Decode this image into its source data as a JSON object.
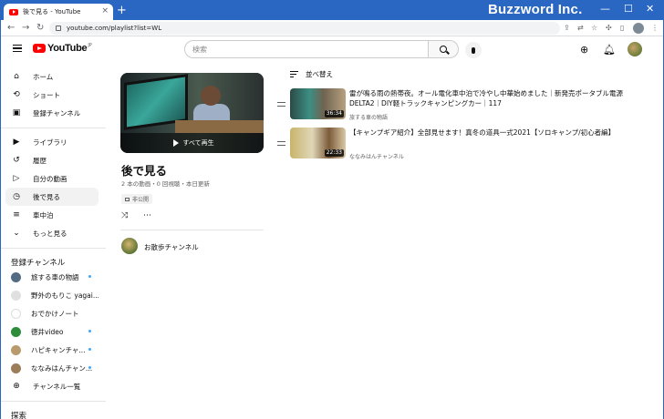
{
  "browser": {
    "tab_title": "後で見る - YouTube",
    "tab_close": "×",
    "new_tab": "+",
    "brand": "Buzzword Inc.",
    "win_min": "—",
    "win_max": "☐",
    "win_close": "✕",
    "nav_back": "←",
    "nav_forward": "→",
    "nav_reload": "↻",
    "url": "youtube.com/playlist?list=WL"
  },
  "masthead": {
    "logo_text": "YouTube",
    "logo_region": "JP",
    "search_placeholder": "検索",
    "create_glyph": "⊕",
    "bell_glyph": "🔔︎"
  },
  "sidebar": {
    "main": [
      {
        "label": "ホーム",
        "icon": "⌂"
      },
      {
        "label": "ショート",
        "icon": "⟲"
      },
      {
        "label": "登録チャンネル",
        "icon": "▣"
      }
    ],
    "library": [
      {
        "label": "ライブラリ",
        "icon": "▶"
      },
      {
        "label": "履歴",
        "icon": "↺"
      },
      {
        "label": "自分の動画",
        "icon": "▷"
      },
      {
        "label": "後で見る",
        "icon": "◷",
        "active": true
      },
      {
        "label": "車中泊",
        "icon": "≡"
      },
      {
        "label": "もっと見る",
        "icon": "⌄"
      }
    ],
    "subscriptions_heading": "登録チャンネル",
    "subscriptions": [
      {
        "label": "旅する車の物語",
        "new": true,
        "color": "#546b84"
      },
      {
        "label": "野外のもりこ yagai...",
        "new": false,
        "color": "#e0e0e0"
      },
      {
        "label": "おでかけノート",
        "new": false,
        "color": "#ffffff"
      },
      {
        "label": "徳井video",
        "new": true,
        "color": "#2f8c3a"
      },
      {
        "label": "ハピキャンチャ...",
        "new": true,
        "color": "#b89a6c"
      },
      {
        "label": "ななみはんチャン...",
        "new": true,
        "color": "#9c7d5a"
      },
      {
        "label": "チャンネル一覧",
        "new": false,
        "icon": "⊕"
      }
    ],
    "explore_heading": "探索"
  },
  "playlist": {
    "play_all": "すべて再生",
    "title": "後で見る",
    "stats": "2 本の動画・0 回視聴・本日更新",
    "privacy": "非公開",
    "shuffle_glyph": "⤨",
    "more_glyph": "⋯",
    "owner": "お散歩チャンネル",
    "sort_label": "並べ替え"
  },
  "videos": [
    {
      "title": "雷が鳴る雨の熱帯夜。オール電化車中泊で冷やし中華始めました｜新発売ポータブル電源DELTA2｜DIY軽トラックキャンピングカー｜117",
      "channel": "旅する車の物語",
      "duration": "36:34"
    },
    {
      "title": "【キャンプギア紹介】全部見せます！真冬の道具一式2021【ソロキャンプ/初心者編】",
      "channel": "ななみはんチャンネル",
      "duration": "22:33"
    }
  ]
}
